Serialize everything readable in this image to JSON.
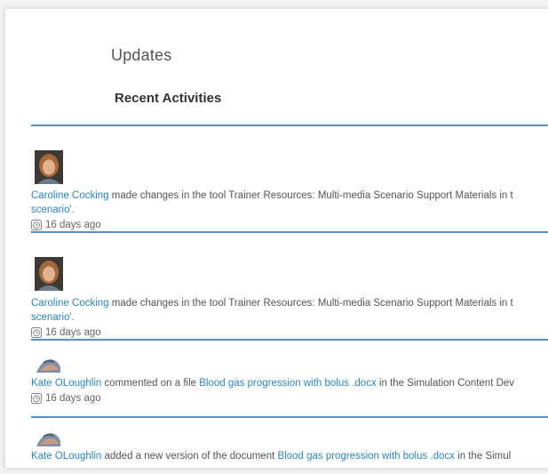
{
  "header": {
    "title": "Updates",
    "subtitle": "Recent Activities"
  },
  "feed": {
    "items": [
      {
        "actor": "Caroline Cocking",
        "text": " made changes in the tool Trainer Resources: Multi-media Scenario Support Materials in t",
        "continuation": "scenario'.",
        "time": "16 days ago",
        "avatar": "woman-portrait"
      },
      {
        "actor": "Caroline Cocking",
        "text": " made changes in the tool Trainer Resources: Multi-media Scenario Support Materials in t",
        "continuation": "scenario'.",
        "time": "16 days ago",
        "avatar": "woman-portrait"
      },
      {
        "actor": "Kate OLoughlin",
        "text": " commented on a file ",
        "file": "Blood gas progression with bolus .docx",
        "suffix": " in the Simulation Content Dev",
        "time": "16 days ago",
        "avatar": "hands-image"
      },
      {
        "actor": "Kate OLoughlin",
        "text": " added a new version of the document ",
        "file": "Blood gas progression with bolus .docx",
        "suffix": " in the Simul",
        "avatar": "hands-image"
      }
    ]
  },
  "colors": {
    "link": "#2a86c7",
    "divider": "#5b8ec7"
  }
}
